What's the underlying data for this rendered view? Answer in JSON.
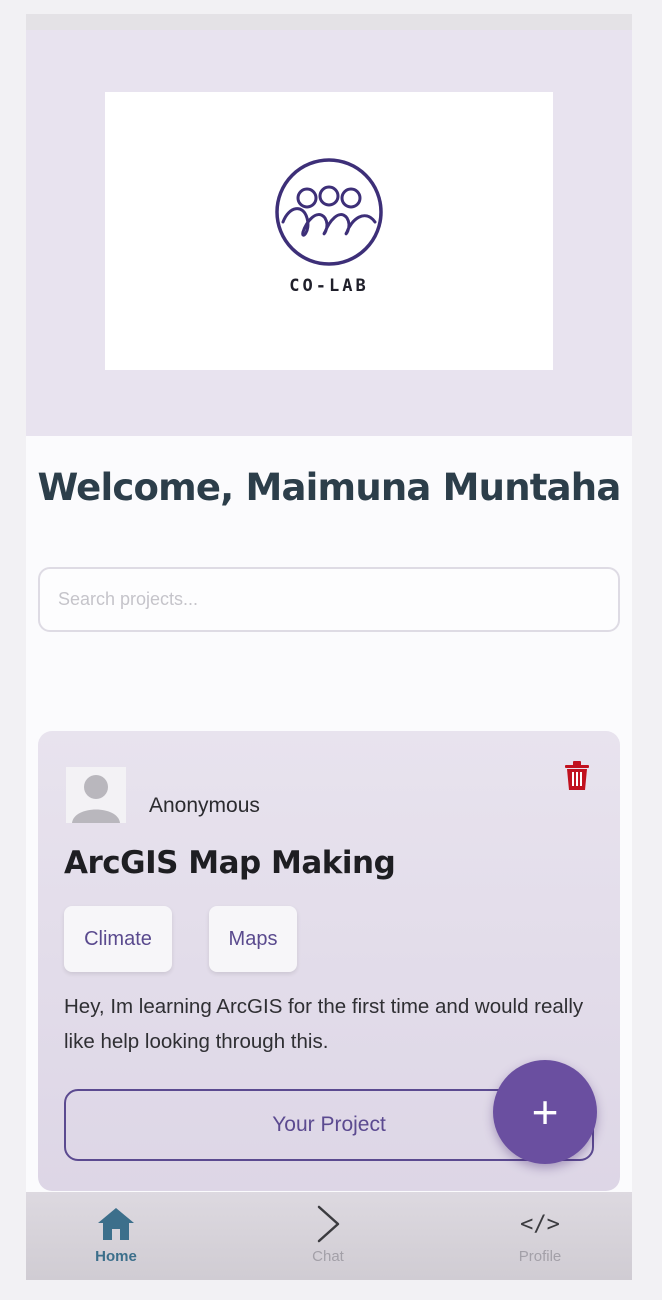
{
  "header": {
    "logo_text": "CO-LAB",
    "welcome_text": "Welcome, Maimuna Muntaha"
  },
  "search": {
    "placeholder": "Search projects...",
    "value": ""
  },
  "project_card": {
    "author": "Anonymous",
    "title": "ArcGIS Map Making",
    "tags": [
      "Climate",
      "Maps"
    ],
    "description": "Hey, Im learning ArcGIS for the first time and would really like help looking through this.",
    "action_label": "Your Project",
    "delete_icon": "trash-icon",
    "avatar_icon": "user-avatar-icon"
  },
  "fab": {
    "label": "+",
    "icon": "plus-icon"
  },
  "bottom_nav": {
    "items": [
      {
        "label": "Home",
        "icon": "home-icon",
        "active": true
      },
      {
        "label": "Chat",
        "icon": "chevron-right-icon",
        "active": false
      },
      {
        "label": "Profile",
        "icon": "code-icon",
        "glyph": "</>",
        "active": false
      }
    ]
  },
  "colors": {
    "accent": "#6a4fa0",
    "header_background": "#e8e3ef",
    "welcome_text": "#2c3e4a",
    "delete": "#c1121f",
    "nav_active": "#3c6f8b"
  }
}
